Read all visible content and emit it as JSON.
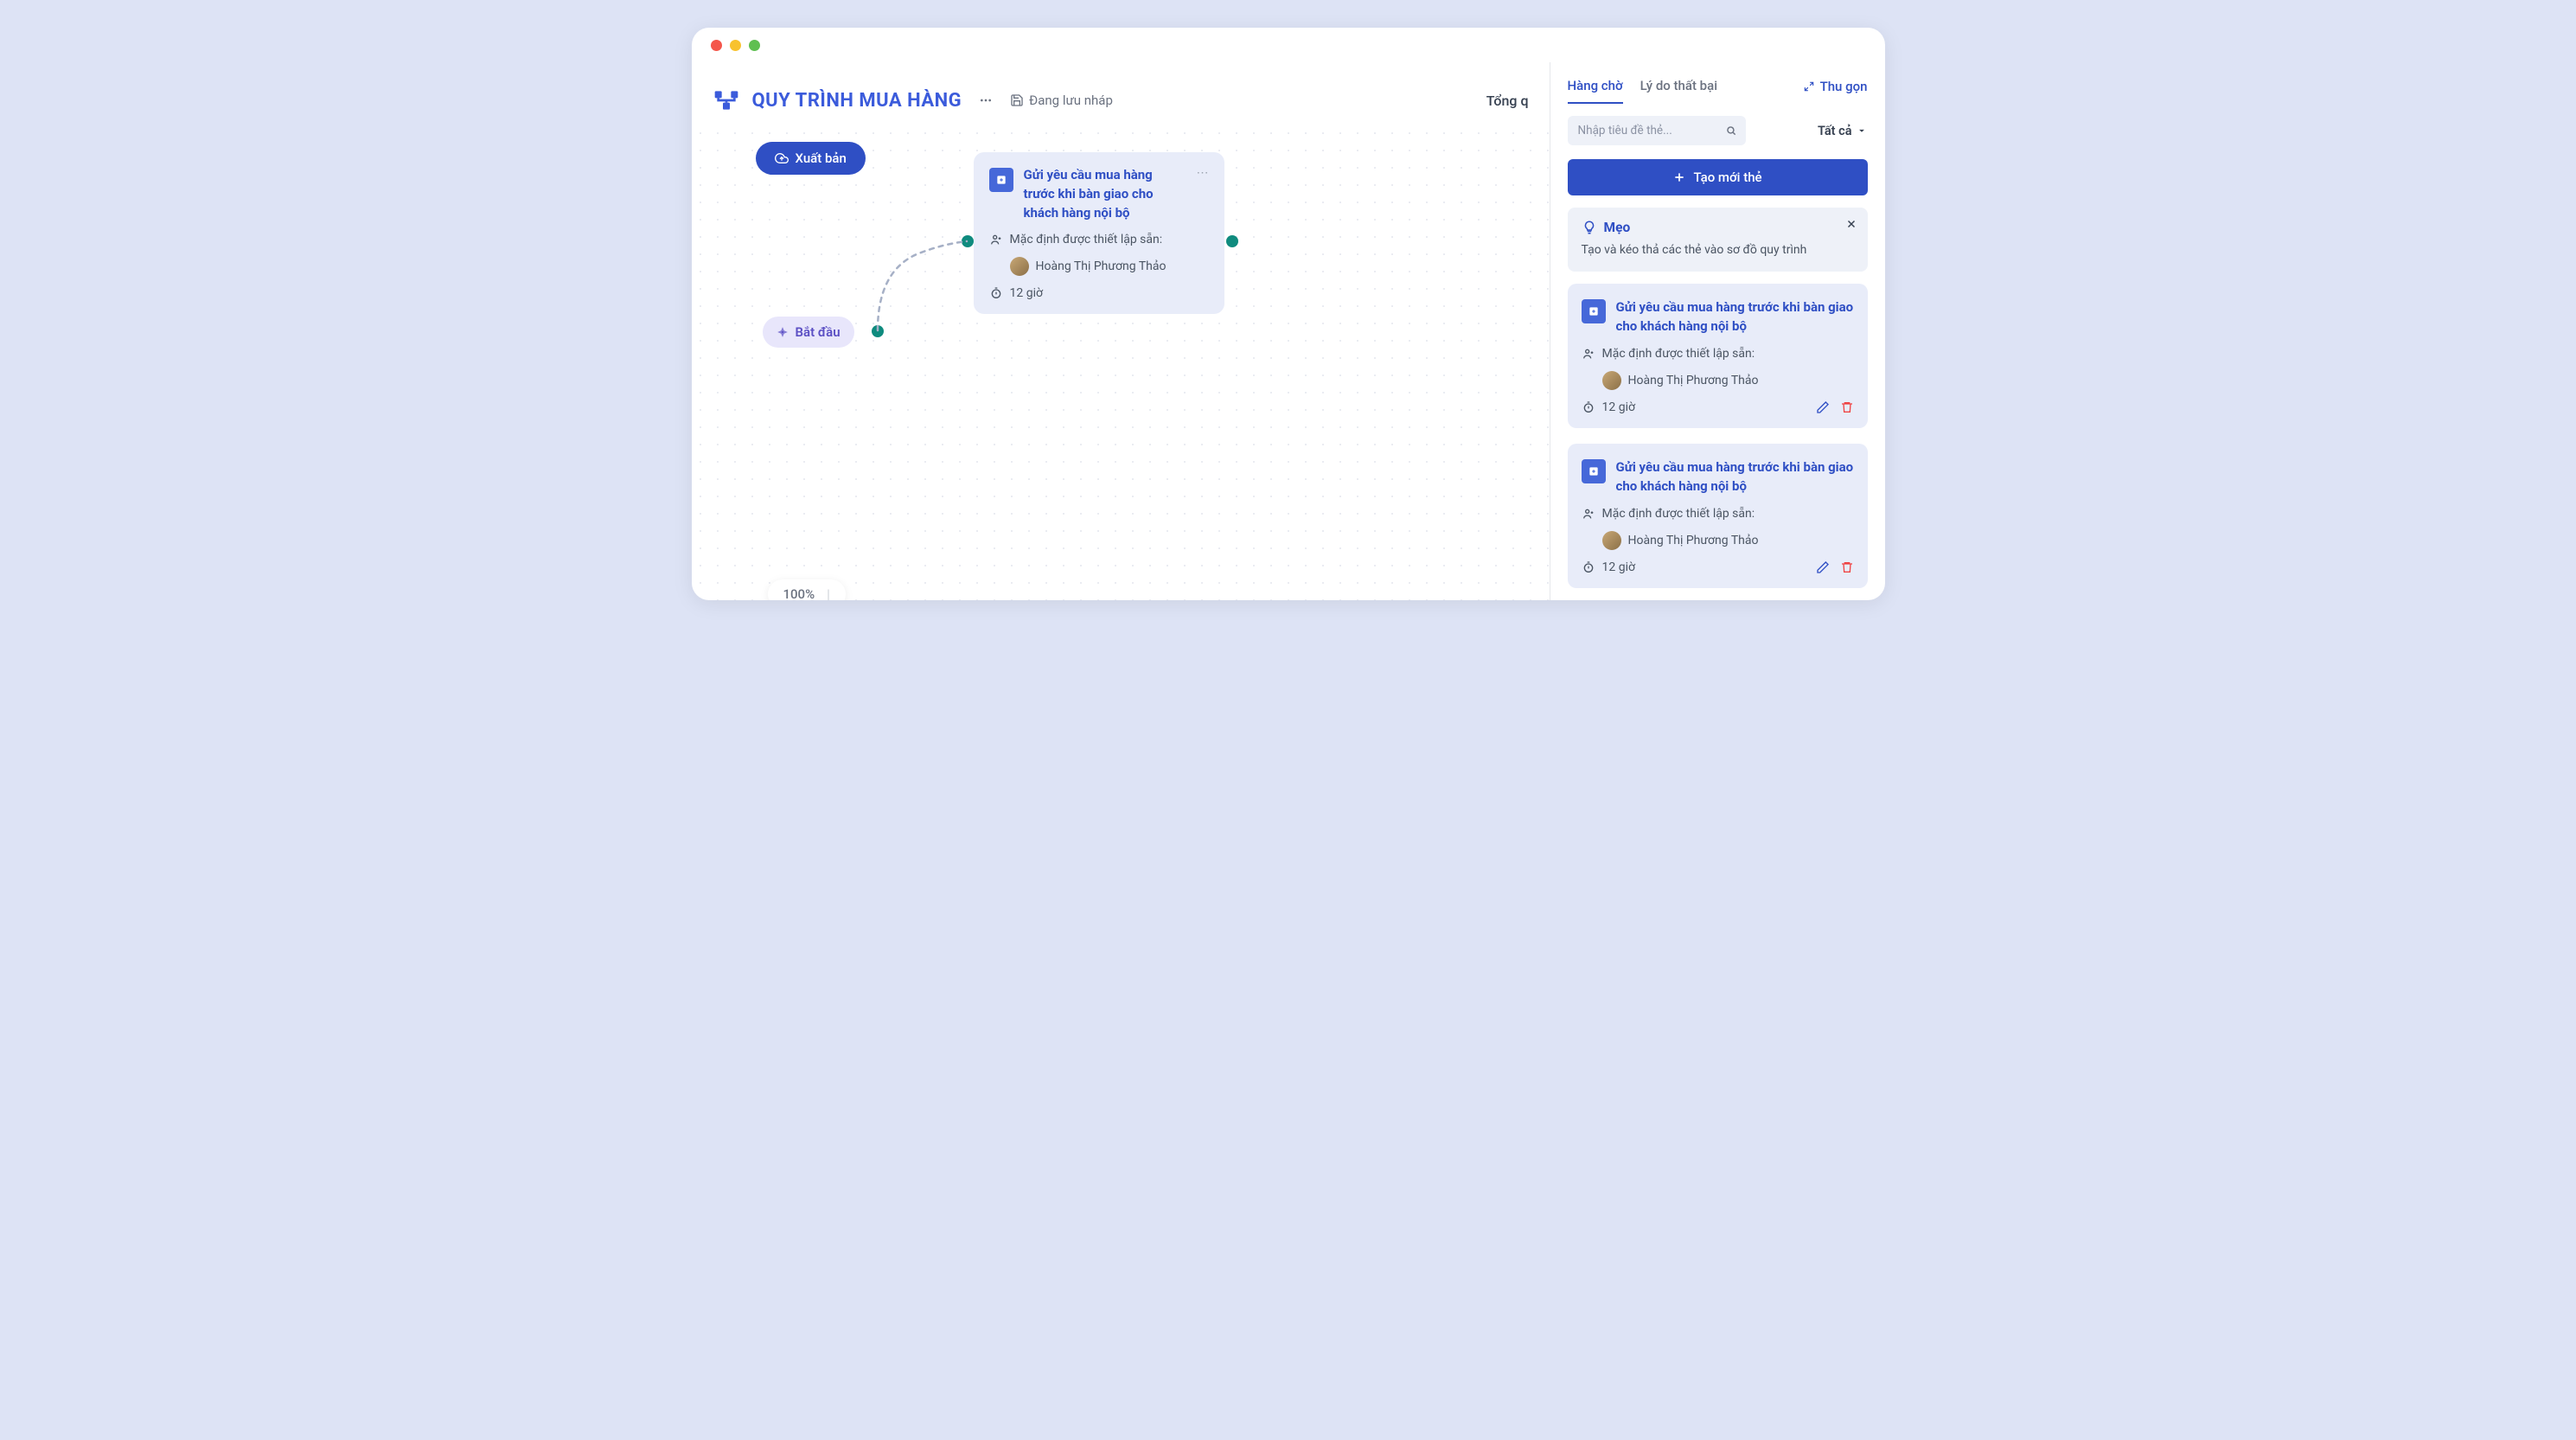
{
  "header": {
    "title": "QUY TRÌNH MUA HÀNG",
    "save_status": "Đang lưu nháp",
    "truncated_right": "Tổng q"
  },
  "canvas": {
    "publish_label": "Xuất bản",
    "start_label": "Bắt đầu",
    "zoom_value": "100%",
    "card": {
      "title": "Gửi yêu cầu mua hàng trước khi bàn giao cho khách hàng nội bộ",
      "assignee_label": "Mặc định được thiết lập sẵn:",
      "assignee_name": "Hoàng Thị Phương Thảo",
      "duration": "12 giờ"
    }
  },
  "sidebar": {
    "tabs": {
      "queue": "Hàng chờ",
      "fail": "Lý do thất bại"
    },
    "collapse_label": "Thu gọn",
    "search_placeholder": "Nhập tiêu đề thẻ...",
    "filter_label": "Tất cả",
    "create_label": "Tạo mới thẻ",
    "tip": {
      "title": "Mẹo",
      "body": "Tạo và kéo thả các thẻ vào sơ đồ quy trình"
    },
    "cards": [
      {
        "title": "Gửi yêu cầu mua hàng trước khi bàn giao cho khách hàng nội bộ",
        "assignee_label": "Mặc định được thiết lập sẵn:",
        "assignee_name": "Hoàng Thị Phương Thảo",
        "duration": "12 giờ"
      },
      {
        "title": "Gửi yêu cầu mua hàng trước khi bàn giao cho khách hàng nội bộ",
        "assignee_label": "Mặc định được thiết lập sẵn:",
        "assignee_name": "Hoàng Thị Phương Thảo",
        "duration": "12 giờ"
      }
    ]
  }
}
